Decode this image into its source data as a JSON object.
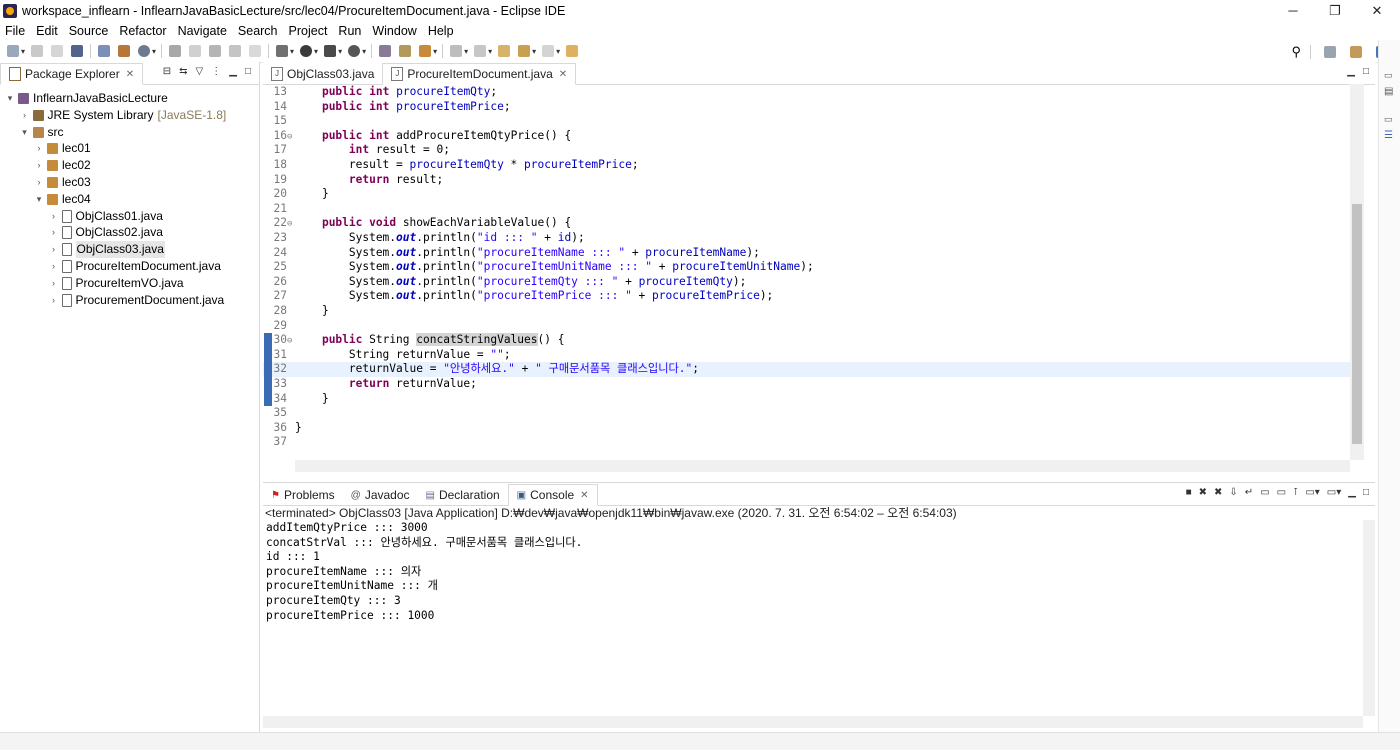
{
  "window": {
    "title": "workspace_inflearn - InflearnJavaBasicLecture/src/lec04/ProcureItemDocument.java - Eclipse IDE",
    "controls": [
      "─",
      "❐",
      "✕"
    ]
  },
  "menu": [
    "File",
    "Edit",
    "Source",
    "Refactor",
    "Navigate",
    "Search",
    "Project",
    "Run",
    "Window",
    "Help"
  ],
  "package_explorer": {
    "title": "Package Explorer",
    "tree": [
      {
        "label": "InflearnJavaBasicLecture",
        "suffix": "",
        "arrow": "▾",
        "icon": "project-icon"
      },
      {
        "label": "JRE System Library",
        "suffix": "[JavaSE-1.8]",
        "arrow": "›",
        "icon": "library-icon"
      },
      {
        "label": "src",
        "suffix": "",
        "arrow": "▾",
        "icon": "source-folder-icon"
      },
      {
        "label": "lec01",
        "suffix": "",
        "arrow": "›",
        "icon": "package-icon"
      },
      {
        "label": "lec02",
        "suffix": "",
        "arrow": "›",
        "icon": "package-icon"
      },
      {
        "label": "lec03",
        "suffix": "",
        "arrow": "›",
        "icon": "package-icon"
      },
      {
        "label": "lec04",
        "suffix": "",
        "arrow": "▾",
        "icon": "package-icon"
      },
      {
        "label": "ObjClass01.java",
        "suffix": "",
        "arrow": "›",
        "icon": "java-file-icon"
      },
      {
        "label": "ObjClass02.java",
        "suffix": "",
        "arrow": "›",
        "icon": "java-file-icon"
      },
      {
        "label": "ObjClass03.java",
        "suffix": "",
        "arrow": "›",
        "icon": "java-file-icon",
        "selected": true
      },
      {
        "label": "ProcureItemDocument.java",
        "suffix": "",
        "arrow": "›",
        "icon": "java-file-icon"
      },
      {
        "label": "ProcureItemVO.java",
        "suffix": "",
        "arrow": "›",
        "icon": "java-file-icon"
      },
      {
        "label": "ProcurementDocument.java",
        "suffix": "",
        "arrow": "›",
        "icon": "java-file-icon"
      }
    ]
  },
  "editor": {
    "tabs": [
      {
        "label": "ObjClass03.java",
        "active": false
      },
      {
        "label": "ProcureItemDocument.java",
        "active": true
      }
    ],
    "lines": [
      {
        "n": "13",
        "fold": "",
        "html": "    <span class=\"kw\">public</span> <span class=\"kw\">int</span> <span class=\"fld\">procureItemQty</span>;"
      },
      {
        "n": "14",
        "fold": "",
        "html": "    <span class=\"kw\">public</span> <span class=\"kw\">int</span> <span class=\"fld\">procureItemPrice</span>;"
      },
      {
        "n": "15",
        "fold": "",
        "html": ""
      },
      {
        "n": "16",
        "fold": "⊖",
        "html": "    <span class=\"kw\">public</span> <span class=\"kw\">int</span> addProcureItemQtyPrice() {"
      },
      {
        "n": "17",
        "fold": "",
        "html": "        <span class=\"kw\">int</span> result = 0;"
      },
      {
        "n": "18",
        "fold": "",
        "html": "        result = <span class=\"fld\">procureItemQty</span> * <span class=\"fld\">procureItemPrice</span>;"
      },
      {
        "n": "19",
        "fold": "",
        "html": "        <span class=\"kw\">return</span> result;"
      },
      {
        "n": "20",
        "fold": "",
        "html": "    }"
      },
      {
        "n": "21",
        "fold": "",
        "html": ""
      },
      {
        "n": "22",
        "fold": "⊖",
        "html": "    <span class=\"kw\">public</span> <span class=\"kw\">void</span> showEachVariableValue() {"
      },
      {
        "n": "23",
        "fold": "",
        "html": "        System.<span class=\"st\">out</span>.println(<span class=\"str\">\"id ::: \"</span> + <span class=\"fld\">id</span>);"
      },
      {
        "n": "24",
        "fold": "",
        "html": "        System.<span class=\"st\">out</span>.println(<span class=\"str\">\"procureItemName ::: \"</span> + <span class=\"fld\">procureItemName</span>);"
      },
      {
        "n": "25",
        "fold": "",
        "html": "        System.<span class=\"st\">out</span>.println(<span class=\"str\">\"procureItemUnitName ::: \"</span> + <span class=\"fld\">procureItemUnitName</span>);"
      },
      {
        "n": "26",
        "fold": "",
        "html": "        System.<span class=\"st\">out</span>.println(<span class=\"str\">\"procureItemQty ::: \"</span> + <span class=\"fld\">procureItemQty</span>);"
      },
      {
        "n": "27",
        "fold": "",
        "html": "        System.<span class=\"st\">out</span>.println(<span class=\"str\">\"procureItemPrice ::: \"</span> + <span class=\"fld\">procureItemPrice</span>);"
      },
      {
        "n": "28",
        "fold": "",
        "html": "    }"
      },
      {
        "n": "29",
        "fold": "",
        "html": ""
      },
      {
        "n": "30",
        "fold": "⊖",
        "html": "    <span class=\"kw\">public</span> String <span class=\"occ\">concatStringValues</span>() {"
      },
      {
        "n": "31",
        "fold": "",
        "html": "        String returnValue = <span class=\"str\">\"\"</span>;"
      },
      {
        "n": "32",
        "fold": "",
        "html": "        returnValue = <span class=\"str\">\"안녕하세요.\"</span> + <span class=\"str\">\" 구매문서품목 클래스입니다.\"</span>;",
        "current": true
      },
      {
        "n": "33",
        "fold": "",
        "html": "        <span class=\"kw\">return</span> returnValue;"
      },
      {
        "n": "34",
        "fold": "",
        "html": "    }"
      },
      {
        "n": "35",
        "fold": "",
        "html": ""
      },
      {
        "n": "36",
        "fold": "",
        "html": "}"
      },
      {
        "n": "37",
        "fold": "",
        "html": ""
      }
    ]
  },
  "bottom_panel": {
    "tabs": [
      {
        "label": "Problems",
        "icon": "problems-icon"
      },
      {
        "label": "Javadoc",
        "icon": "javadoc-icon"
      },
      {
        "label": "Declaration",
        "icon": "declaration-icon"
      },
      {
        "label": "Console",
        "icon": "console-icon",
        "active": true
      }
    ],
    "terminated": "<terminated> ObjClass03 [Java Application] D:₩dev₩java₩openjdk11₩bin₩javaw.exe  (2020. 7. 31. 오전 6:54:02 – 오전 6:54:03)",
    "output": [
      "addItemQtyPrice ::: 3000",
      "concatStrVal ::: 안녕하세요. 구매문서품목 클래스입니다.",
      "id ::: 1",
      "procureItemName ::: 의자",
      "procureItemUnitName ::: 개",
      "procureItemQty ::: 3",
      "procureItemPrice ::: 1000"
    ]
  },
  "colors": {
    "keyword": "#7f0055",
    "field": "#0000c0",
    "string": "#2a00ff",
    "current_line": "#e8f2fe",
    "accent": "#3b6bb5"
  }
}
